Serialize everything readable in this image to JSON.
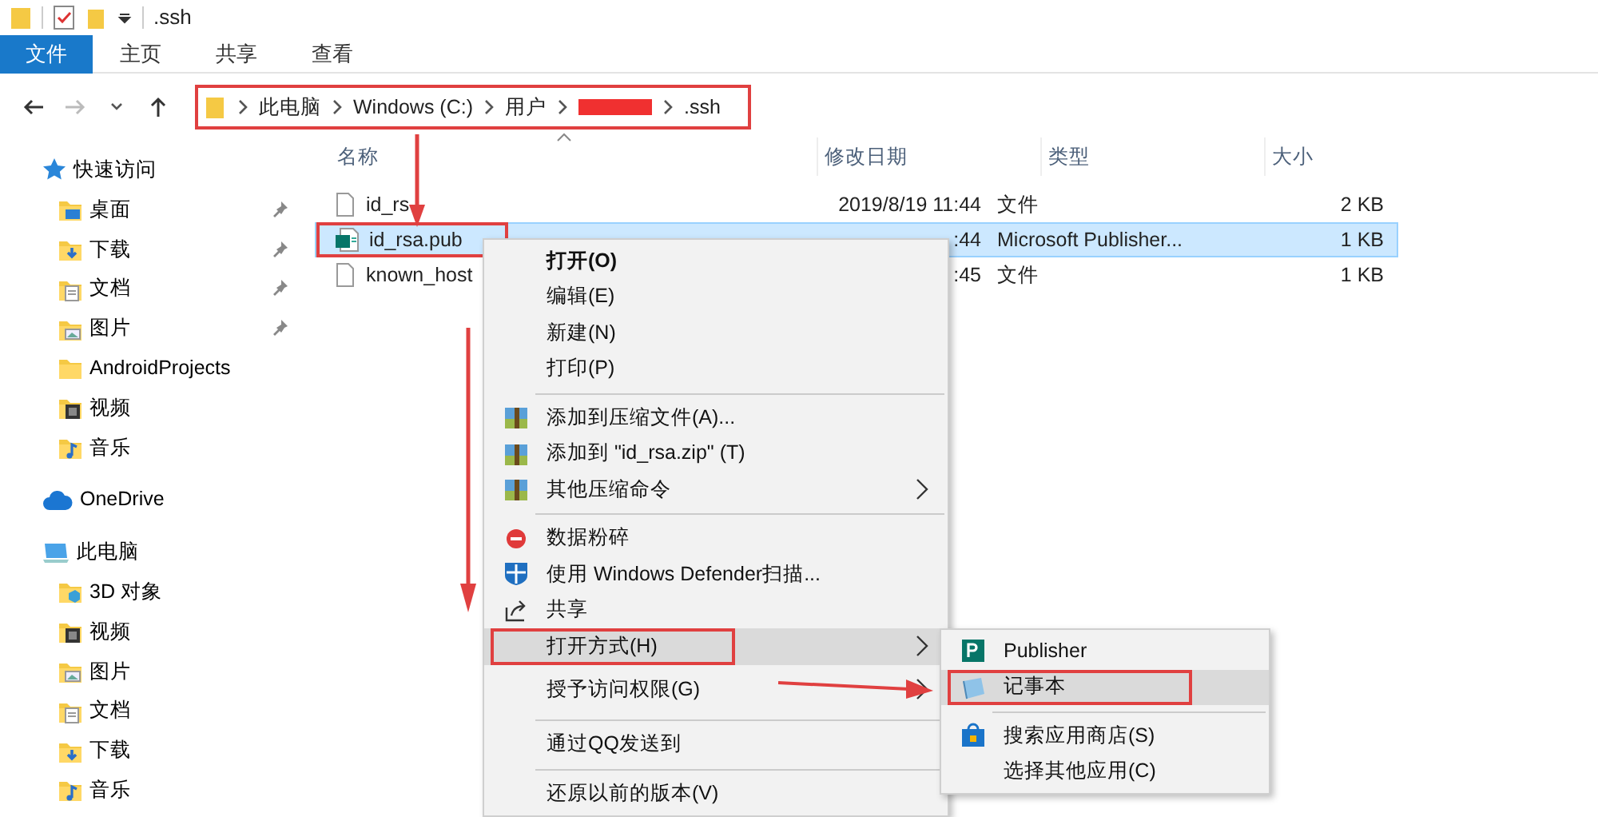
{
  "window": {
    "title": ".ssh"
  },
  "ribbon_tabs": [
    {
      "label": "文件",
      "selected": true
    },
    {
      "label": "主页",
      "selected": false
    },
    {
      "label": "共享",
      "selected": false
    },
    {
      "label": "查看",
      "selected": false
    }
  ],
  "address_bar": {
    "annotated": true,
    "crumbs": [
      {
        "kind": "text",
        "label": "此电脑"
      },
      {
        "kind": "text",
        "label": "Windows (C:)"
      },
      {
        "kind": "text",
        "label": "用户"
      },
      {
        "kind": "redacted"
      },
      {
        "kind": "text",
        "label": ".ssh"
      }
    ]
  },
  "sidebar": {
    "items": [
      {
        "kind": "quick-access",
        "label": "快速访问",
        "children": [
          {
            "kind": "desktop",
            "label": "桌面",
            "pinned": true
          },
          {
            "kind": "downloads",
            "label": "下载",
            "pinned": true
          },
          {
            "kind": "documents",
            "label": "文档",
            "pinned": true
          },
          {
            "kind": "pictures",
            "label": "图片",
            "pinned": true
          },
          {
            "kind": "folder",
            "label": "AndroidProjects",
            "pinned": false
          },
          {
            "kind": "videos",
            "label": "视频",
            "pinned": false
          },
          {
            "kind": "music",
            "label": "音乐",
            "pinned": false
          }
        ]
      },
      {
        "kind": "cloud",
        "label": "OneDrive"
      },
      {
        "kind": "computer",
        "label": "此电脑",
        "children": [
          {
            "kind": "objects",
            "label": "3D 对象",
            "pinned": false
          },
          {
            "kind": "videos",
            "label": "视频",
            "pinned": false
          },
          {
            "kind": "pictures",
            "label": "图片",
            "pinned": false
          },
          {
            "kind": "documents",
            "label": "文档",
            "pinned": false
          },
          {
            "kind": "downloads",
            "label": "下载",
            "pinned": false
          },
          {
            "kind": "music",
            "label": "音乐",
            "pinned": false
          }
        ]
      }
    ]
  },
  "table": {
    "columns": [
      "名称",
      "修改日期",
      "类型",
      "大小"
    ],
    "rows": [
      {
        "kind": "file",
        "name": "id_rs",
        "date": "2019/8/19 11:44",
        "type": "文件",
        "size": "2 KB",
        "selected": false,
        "annotated": false
      },
      {
        "kind": "publisher",
        "name": "id_rsa.pub",
        "date": ":44",
        "type": "Microsoft Publisher...",
        "size": "1 KB",
        "selected": true,
        "annotated": true
      },
      {
        "kind": "file",
        "name": "known_host",
        "date": ":45",
        "type": "文件",
        "size": "1 KB",
        "selected": false,
        "annotated": false
      }
    ]
  },
  "context_menu": {
    "items": [
      {
        "kind": "plain",
        "label": "打开(O)",
        "bold": true,
        "submenu": false,
        "selected": false,
        "annotated": false
      },
      {
        "kind": "plain",
        "label": "编辑(E)",
        "bold": false,
        "submenu": false,
        "selected": false,
        "annotated": false
      },
      {
        "kind": "plain",
        "label": "新建(N)",
        "bold": false,
        "submenu": false,
        "selected": false,
        "annotated": false
      },
      {
        "kind": "plain",
        "label": "打印(P)",
        "bold": false,
        "submenu": false,
        "selected": false,
        "annotated": false
      },
      {
        "kind": "separator"
      },
      {
        "kind": "archive",
        "label": "添加到压缩文件(A)...",
        "bold": false,
        "submenu": false,
        "selected": false,
        "annotated": false
      },
      {
        "kind": "archive",
        "label": "添加到 \"id_rsa.zip\" (T)",
        "bold": false,
        "submenu": false,
        "selected": false,
        "annotated": false
      },
      {
        "kind": "archive",
        "label": "其他压缩命令",
        "bold": false,
        "submenu": true,
        "selected": false,
        "annotated": false
      },
      {
        "kind": "separator"
      },
      {
        "kind": "shred",
        "label": "数据粉碎",
        "bold": false,
        "submenu": false,
        "selected": false,
        "annotated": false
      },
      {
        "kind": "shield",
        "label": "使用 Windows Defender扫描...",
        "bold": false,
        "submenu": false,
        "selected": false,
        "annotated": false
      },
      {
        "kind": "share",
        "label": "共享",
        "bold": false,
        "submenu": false,
        "selected": false,
        "annotated": false
      },
      {
        "kind": "plain",
        "label": "打开方式(H)",
        "bold": false,
        "submenu": true,
        "selected": true,
        "annotated": true
      },
      {
        "kind": "plain",
        "label": "授予访问权限(G)",
        "bold": false,
        "submenu": true,
        "selected": false,
        "annotated": false
      },
      {
        "kind": "separator"
      },
      {
        "kind": "plain",
        "label": "通过QQ发送到",
        "bold": false,
        "submenu": false,
        "selected": false,
        "annotated": false
      },
      {
        "kind": "separator"
      },
      {
        "kind": "plain",
        "label": "还原以前的版本(V)",
        "bold": false,
        "submenu": false,
        "selected": false,
        "annotated": false
      }
    ]
  },
  "submenu": {
    "items": [
      {
        "kind": "publisher",
        "label": "Publisher",
        "selected": false,
        "annotated": false
      },
      {
        "kind": "notepad",
        "label": "记事本",
        "selected": true,
        "annotated": true
      },
      {
        "kind": "separator"
      },
      {
        "kind": "store",
        "label": "搜索应用商店(S)",
        "selected": false,
        "annotated": false
      },
      {
        "kind": "plain",
        "label": "选择其他应用(C)",
        "selected": false,
        "annotated": false
      }
    ]
  }
}
